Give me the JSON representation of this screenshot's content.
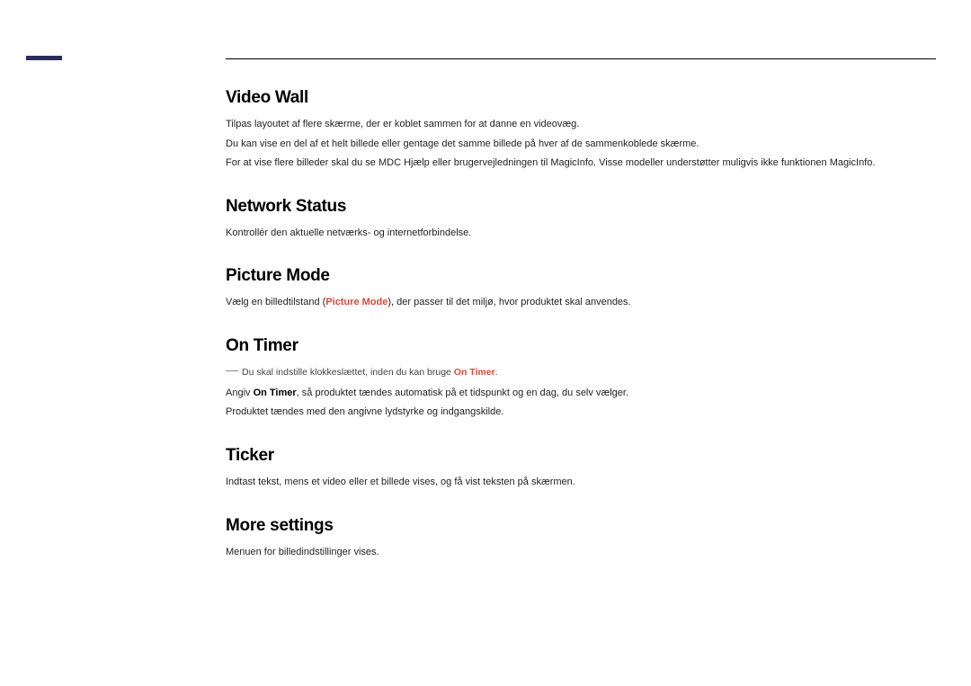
{
  "sections": {
    "videoWall": {
      "title": "Video Wall",
      "p1": "Tilpas layoutet af flere skærme, der er koblet sammen for at danne en videovæg.",
      "p2": "Du kan vise en del af et helt billede eller gentage det samme billede på hver af de sammenkoblede skærme.",
      "p3": "For at vise flere billeder skal du se MDC Hjælp eller brugervejledningen til MagicInfo. Visse modeller understøtter muligvis ikke funktionen MagicInfo."
    },
    "networkStatus": {
      "title": "Network Status",
      "p1": "Kontrollér den aktuelle netværks- og internetforbindelse."
    },
    "pictureMode": {
      "title": "Picture Mode",
      "p1_before": "Vælg en billedtilstand (",
      "p1_highlight": "Picture Mode",
      "p1_after": "), der passer til det miljø, hvor produktet skal anvendes."
    },
    "onTimer": {
      "title": "On Timer",
      "note_before": "Du skal indstille klokkeslættet, inden du kan bruge ",
      "note_highlight": "On Timer",
      "note_after": ".",
      "p1_before": "Angiv ",
      "p1_highlight": "On Timer",
      "p1_after": ", så produktet tændes automatisk på et tidspunkt og en dag, du selv vælger.",
      "p2": "Produktet tændes med den angivne lydstyrke og indgangskilde."
    },
    "ticker": {
      "title": "Ticker",
      "p1": "Indtast tekst, mens et video eller et billede vises, og få vist teksten på skærmen."
    },
    "moreSettings": {
      "title": "More settings",
      "p1": "Menuen for billedindstillinger vises."
    }
  }
}
